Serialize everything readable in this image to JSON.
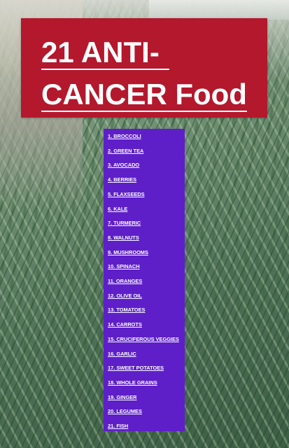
{
  "title": {
    "line1": "21 ANTI-",
    "line2": "CANCER Food"
  },
  "list": {
    "items": [
      "1. BROCCOLI",
      "2. GREEN TEA",
      "3. AVOCADO",
      "4. BERRIES",
      "5. FLAXSEEDS",
      "6. KALE",
      "7. TURMERIC",
      "8. WALNUTS",
      "9. MUSHROOMS",
      "10. SPINACH",
      "11. ORANGES",
      "12. OLIVE OIL",
      "13. TOMATOES",
      "14. CARROTS",
      "15. CRUCIFEROUS VEGGIES",
      "16. GARLIC",
      "17. SWEET POTATOES",
      "18. WHOLE GRAINS",
      "19. GINGER",
      "20. LEGUMES",
      "21. FISH"
    ]
  },
  "colors": {
    "title_bg": "#b3182c",
    "list_bg": "#5e1fc9",
    "text": "#ffffff"
  },
  "background": {
    "description_icon": "grass-leaves-photo"
  }
}
